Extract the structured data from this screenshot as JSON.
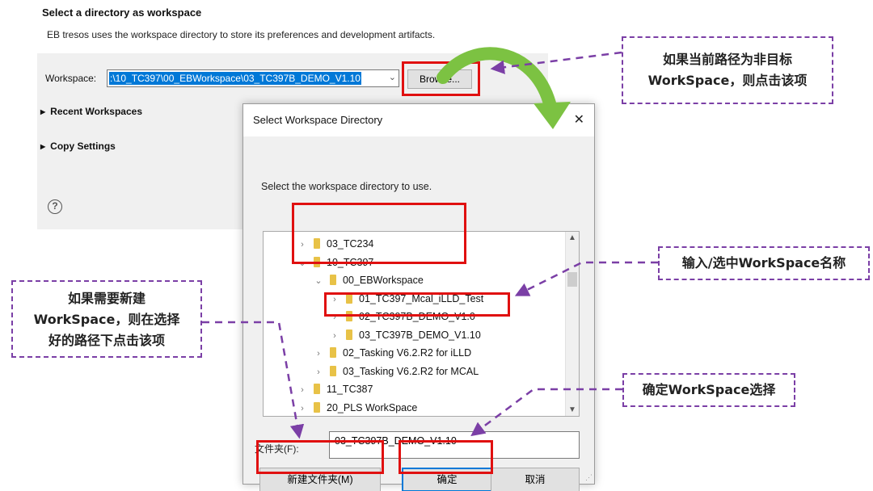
{
  "launcher": {
    "title": "Select a directory as workspace",
    "description": "EB tresos uses the workspace directory to store its preferences and development artifacts.",
    "workspace_label": "Workspace:",
    "workspace_value": ":\\10_TC397\\00_EBWorkspace\\03_TC397B_DEMO_V1.10",
    "browse_label": "Browse...",
    "recent_workspaces": "Recent Workspaces",
    "copy_settings": "Copy Settings",
    "help_symbol": "?"
  },
  "dialog": {
    "title": "Select Workspace Directory",
    "close_symbol": "✕",
    "instruction": "Select the workspace directory to use.",
    "tree": [
      {
        "label": "03_TC234",
        "level": 0,
        "expanded": false
      },
      {
        "label": "10_TC397",
        "level": 0,
        "expanded": true
      },
      {
        "label": "00_EBWorkspace",
        "level": 1,
        "expanded": true
      },
      {
        "label": "01_TC397_Mcal_iLLD_Test",
        "level": 2,
        "expanded": false
      },
      {
        "label": "02_TC397B_DEMO_V1.0",
        "level": 2,
        "expanded": false
      },
      {
        "label": "03_TC397B_DEMO_V1.10",
        "level": 2,
        "expanded": false
      },
      {
        "label": "02_Tasking V6.2.R2 for iLLD",
        "level": 1,
        "expanded": false
      },
      {
        "label": "03_Tasking V6.2.R2 for MCAL",
        "level": 1,
        "expanded": false
      },
      {
        "label": "11_TC387",
        "level": 0,
        "expanded": false
      },
      {
        "label": "20_PLS WorkSpace",
        "level": 0,
        "expanded": false
      }
    ],
    "folder_label": "文件夹(F):",
    "folder_value": "03_TC397B_DEMO_V1.10",
    "new_folder_button": "新建文件夹(M)",
    "ok_button": "确定",
    "cancel_button": "取消"
  },
  "annotations": {
    "browse_note": [
      "如果当前路径为非目标",
      "WorkSpace，则点击该项"
    ],
    "select_note": "输入/选中WorkSpace名称",
    "new_folder_note": [
      "如果需要新建",
      "WorkSpace，则在选择",
      "好的路径下点击该项"
    ],
    "confirm_note": "确定WorkSpace选择"
  },
  "colors": {
    "highlight_red": "#e01010",
    "annotation_purple": "#7b3fa6",
    "arrow_green": "#7cc242",
    "selection_blue": "#0078d7",
    "folder_yellow": "#e8c247"
  }
}
